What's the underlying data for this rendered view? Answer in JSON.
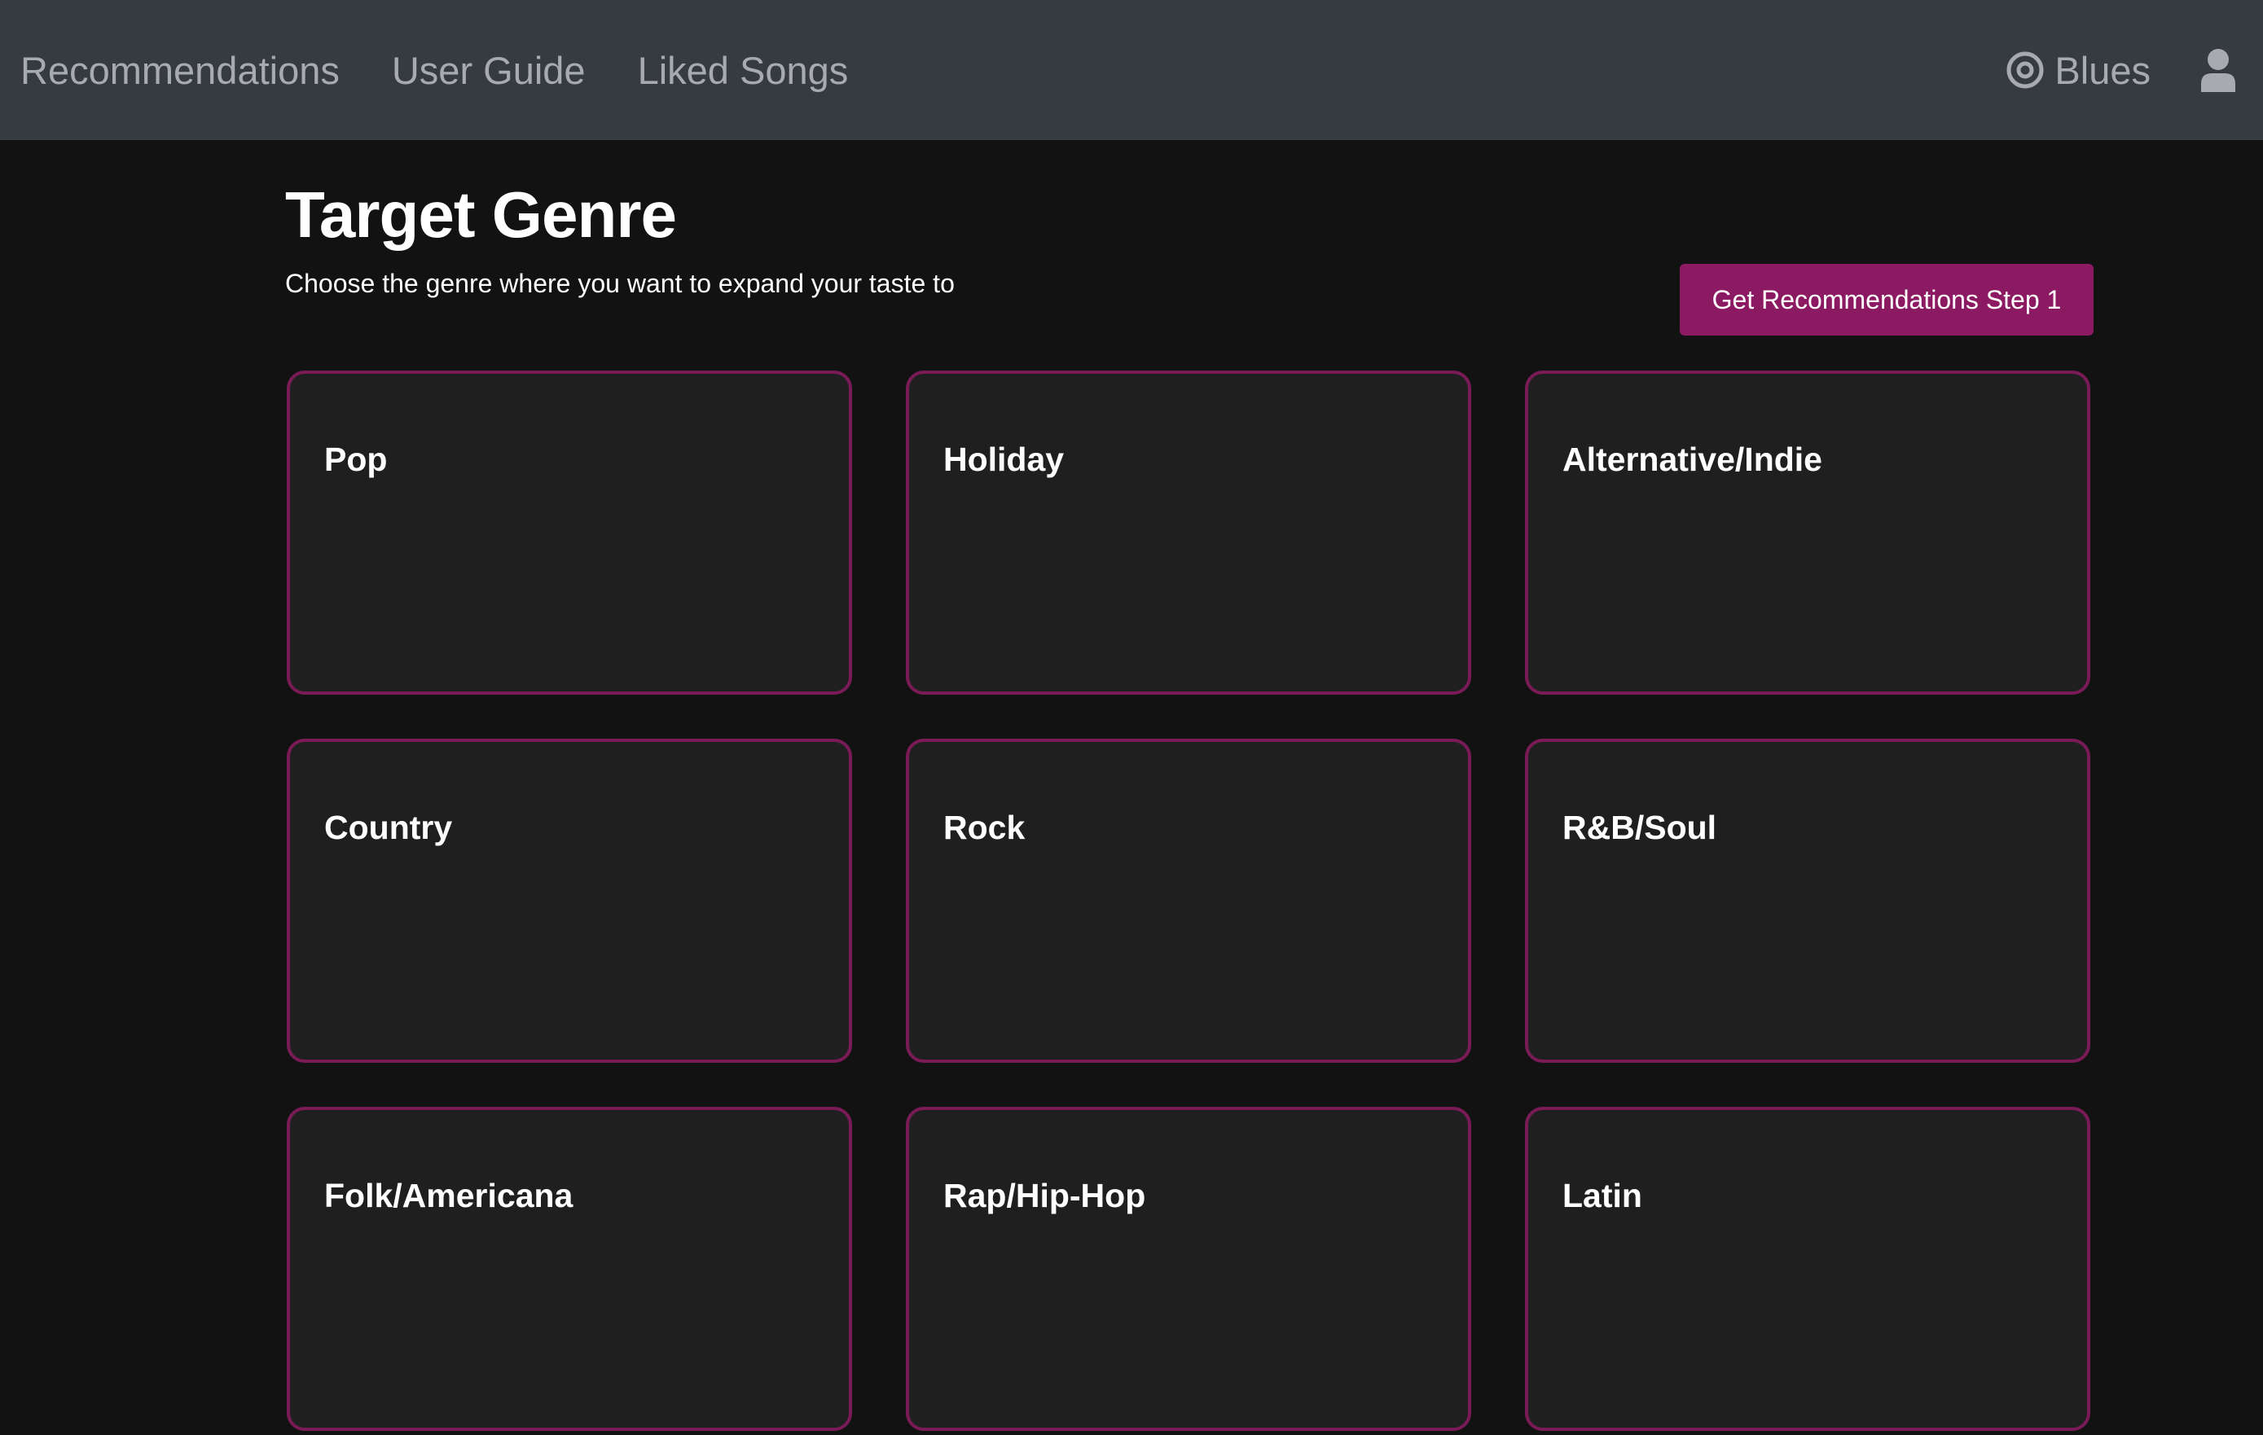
{
  "nav": {
    "links": [
      {
        "label": "Recommendations"
      },
      {
        "label": "User Guide"
      },
      {
        "label": "Liked Songs"
      }
    ],
    "current_genre": "Blues",
    "current_genre_icon": "target-icon",
    "user_icon": "user-icon"
  },
  "page": {
    "title": "Target Genre",
    "subtitle": "Choose the genre where you want to expand your taste to",
    "cta_label": "Get Recommendations Step 1"
  },
  "genres": [
    {
      "label": "Pop"
    },
    {
      "label": "Holiday"
    },
    {
      "label": "Alternative/Indie"
    },
    {
      "label": "Country"
    },
    {
      "label": "Rock"
    },
    {
      "label": "R&B/Soul"
    },
    {
      "label": "Folk/Americana"
    },
    {
      "label": "Rap/Hip-Hop"
    },
    {
      "label": "Latin"
    }
  ],
  "colors": {
    "nav_background": "#363b40",
    "page_background": "#121212",
    "card_background": "#1f1f20",
    "accent": "#8c1a63",
    "card_border": "#7a1b58"
  }
}
